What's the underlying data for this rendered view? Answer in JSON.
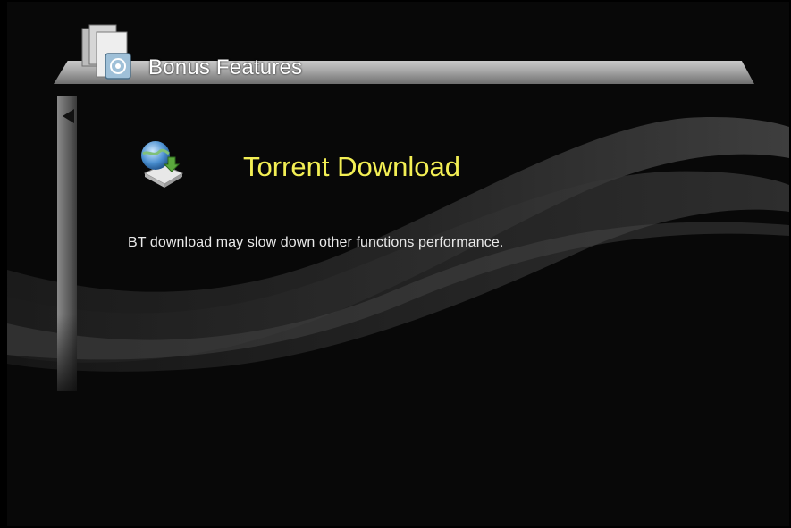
{
  "header": {
    "title": "Bonus Features",
    "icon": "folder-gear-icon"
  },
  "side_nav": {
    "arrow_icon": "triangle-left-icon"
  },
  "feature": {
    "title": "Torrent Download",
    "icon": "globe-download-icon",
    "title_color": "#f3ef54"
  },
  "message": {
    "text": "BT download may slow down other functions performance."
  }
}
